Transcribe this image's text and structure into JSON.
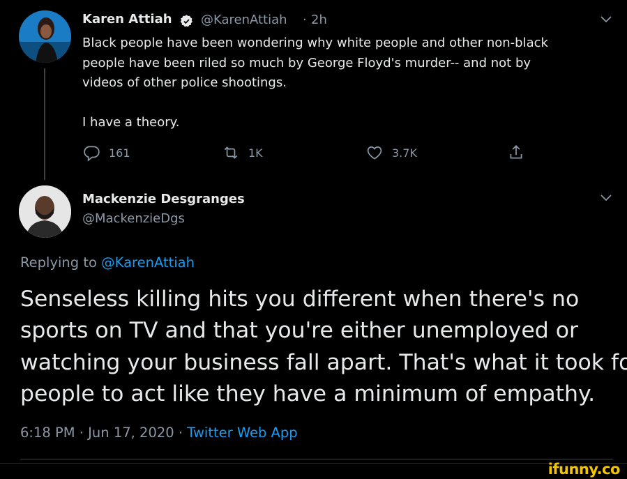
{
  "tweet": {
    "author_name": "Karen Attiah",
    "verified_icon": "verified-badge-icon",
    "handle": "@KarenAttiah",
    "separator": "·",
    "time": "2h",
    "lines": [
      "Black people have been wondering why white people and other non-black",
      "people have been riled so much by George Floyd's murder-- and not by",
      "videos of other police shootings.",
      "",
      "I have a theory."
    ],
    "actions": {
      "reply_count": "161",
      "retweet_count": "1K",
      "like_count": "3.7K"
    }
  },
  "reply": {
    "author_name": "Mackenzie Desgranges",
    "handle": "@MackenzieDgs",
    "replying_prefix": "Replying to",
    "replying_to": "@KarenAttiah",
    "lines": [
      "Senseless killing hits you different when there's no",
      "sports on TV and that you're either unemployed or",
      "watching your business fall apart. That's what it took for",
      "people to act like they have a minimum of empathy."
    ],
    "timestamp": "6:18 PM · Jun 17, 2020 ·",
    "source": "Twitter Web App"
  },
  "watermark": "ifunny.co",
  "colors": {
    "accent": "#1d9bf0",
    "muted": "#8b98a5",
    "text": "#e7e9ea",
    "watermark": "#f2c500"
  }
}
